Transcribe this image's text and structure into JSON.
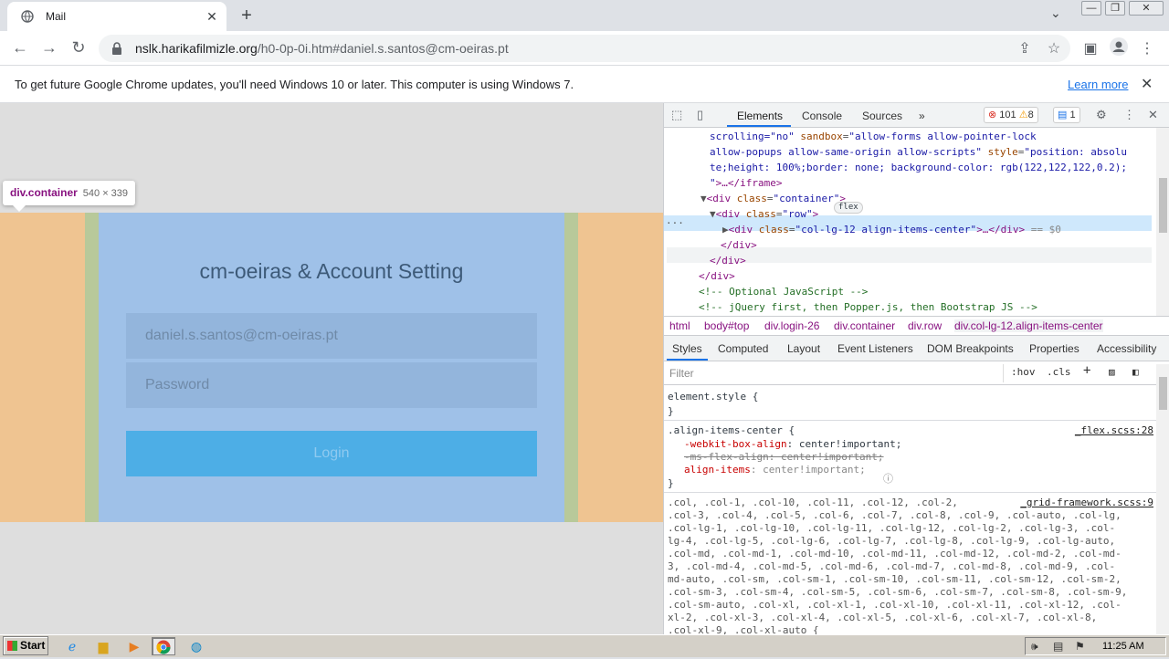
{
  "browser": {
    "tab_title": "Mail",
    "tab_close": "✕",
    "new_tab": "+",
    "tab_menu": "⌄",
    "url_host": "nslk.harikafilmizle.org",
    "url_path": "/h0-0p-0i.htm#daniel.s.santos@cm-oeiras.pt",
    "win_min": "—",
    "win_max": "❐",
    "win_close": "✕"
  },
  "infobar": {
    "message": "To get future Google Chrome updates, you'll need Windows 10 or later. This computer is using Windows 7.",
    "learn_more": "Learn more",
    "close": "✕"
  },
  "page": {
    "tooltip_tag": "div.container",
    "tooltip_dims": "540 × 339",
    "login_title": "cm-oeiras & Account Setting",
    "email_value": "daniel.s.santos@cm-oeiras.pt",
    "password_placeholder": "Password",
    "login_button": "Login"
  },
  "devtools": {
    "tabs": [
      "Elements",
      "Console",
      "Sources",
      "»"
    ],
    "errors": "101",
    "warnings": "8",
    "messages": "1",
    "elements_lines": [
      {
        "indent": 50,
        "parts": [
          [
            "val",
            "scrolling=\"no\" "
          ],
          [
            "attr",
            "sandbox"
          ],
          [
            "",
            "="
          ],
          [
            "val",
            "\"allow-forms allow-pointer-lock"
          ]
        ]
      },
      {
        "indent": 50,
        "parts": [
          [
            "val",
            "allow-popups allow-same-origin allow-scripts\" "
          ],
          [
            "attr",
            "style"
          ],
          [
            "",
            "="
          ],
          [
            "val",
            "\"position: absolu"
          ]
        ]
      },
      {
        "indent": 50,
        "parts": [
          [
            "val",
            "te;height: 100%;border: none; background-color: rgb(122,122,122,0.2);"
          ]
        ]
      },
      {
        "indent": 50,
        "parts": [
          [
            "val",
            "\""
          ],
          [
            "tag",
            ">…</iframe>"
          ]
        ]
      },
      {
        "indent": 40,
        "parts": [
          [
            "",
            "▼"
          ],
          [
            "tag",
            "<div "
          ],
          [
            "attr",
            "class"
          ],
          [
            "",
            "="
          ],
          [
            "val",
            "\"container\""
          ],
          [
            "tag",
            ">"
          ]
        ]
      },
      {
        "indent": 50,
        "parts": [
          [
            "",
            "▼"
          ],
          [
            "tag",
            "<div "
          ],
          [
            "attr",
            "class"
          ],
          [
            "",
            "="
          ],
          [
            "val",
            "\"row\""
          ],
          [
            "tag",
            ">"
          ]
        ]
      },
      {
        "indent": 64,
        "parts": [
          [
            "",
            "▶"
          ],
          [
            "tag",
            "<div "
          ],
          [
            "attr",
            "class"
          ],
          [
            "",
            "="
          ],
          [
            "val",
            "\"col-lg-12 align-items-center\""
          ],
          [
            "tag",
            ">…</div>"
          ],
          [
            "",
            " == $0"
          ]
        ]
      },
      {
        "indent": 62,
        "parts": [
          [
            "tag",
            "</div>"
          ]
        ]
      },
      {
        "indent": 50,
        "parts": [
          [
            "tag",
            "</div>"
          ]
        ]
      },
      {
        "indent": 38,
        "parts": [
          [
            "tag",
            "</div>"
          ]
        ]
      },
      {
        "indent": 38,
        "parts": [
          [
            "cmt",
            "<!-- Optional JavaScript -->"
          ]
        ]
      },
      {
        "indent": 38,
        "parts": [
          [
            "cmt",
            "<!-- jQuery first, then Popper.js, then Bootstrap JS -->"
          ]
        ]
      }
    ],
    "flex_badge": "flex",
    "dots": "···",
    "breadcrumbs": [
      "html",
      "body#top",
      "div.login-26",
      "div.container",
      "div.row",
      "div.col-lg-12.align-items-center"
    ],
    "style_tabs": [
      "Styles",
      "Computed",
      "Layout",
      "Event Listeners",
      "DOM Breakpoints",
      "Properties",
      "Accessibility"
    ],
    "filter_placeholder": "Filter",
    "hov": ":hov",
    "cls": ".cls",
    "element_style": "element.style {",
    "close_brace": "}",
    "rule1_selector": ".align-items-center {",
    "rule1_source": "_flex.scss:28",
    "rule1_props": [
      {
        "name": "-webkit-box-align",
        "value": "center!important;",
        "struck": false
      },
      {
        "name": "-ms-flex-align",
        "value": "center!important;",
        "struck": true
      },
      {
        "name": "align-items",
        "value": "center!important;",
        "struck": false
      }
    ],
    "rule2_source": "_grid-framework.scss:9",
    "rule2_lines": [
      ".col, .col-1, .col-10, .col-11, .col-12, .col-2,",
      ".col-3, .col-4, .col-5, .col-6, .col-7, .col-8, .col-9, .col-auto, .col-lg,",
      ".col-lg-1, .col-lg-10, .col-lg-11, .col-lg-12, .col-lg-2, .col-lg-3, .col-",
      "lg-4, .col-lg-5, .col-lg-6, .col-lg-7, .col-lg-8, .col-lg-9, .col-lg-auto,",
      ".col-md, .col-md-1, .col-md-10, .col-md-11, .col-md-12, .col-md-2, .col-md-",
      "3, .col-md-4, .col-md-5, .col-md-6, .col-md-7, .col-md-8, .col-md-9, .col-",
      "md-auto, .col-sm, .col-sm-1, .col-sm-10, .col-sm-11, .col-sm-12, .col-sm-2,",
      ".col-sm-3, .col-sm-4, .col-sm-5, .col-sm-6, .col-sm-7, .col-sm-8, .col-sm-9,",
      ".col-sm-auto, .col-xl, .col-xl-1, .col-xl-10, .col-xl-11, .col-xl-12, .col-",
      "xl-2, .col-xl-3, .col-xl-4, .col-xl-5, .col-xl-6, .col-xl-7, .col-xl-8,",
      ".col-xl-9, .col-xl-auto {"
    ]
  },
  "taskbar": {
    "start": "Start",
    "clock": "11:25 AM"
  }
}
